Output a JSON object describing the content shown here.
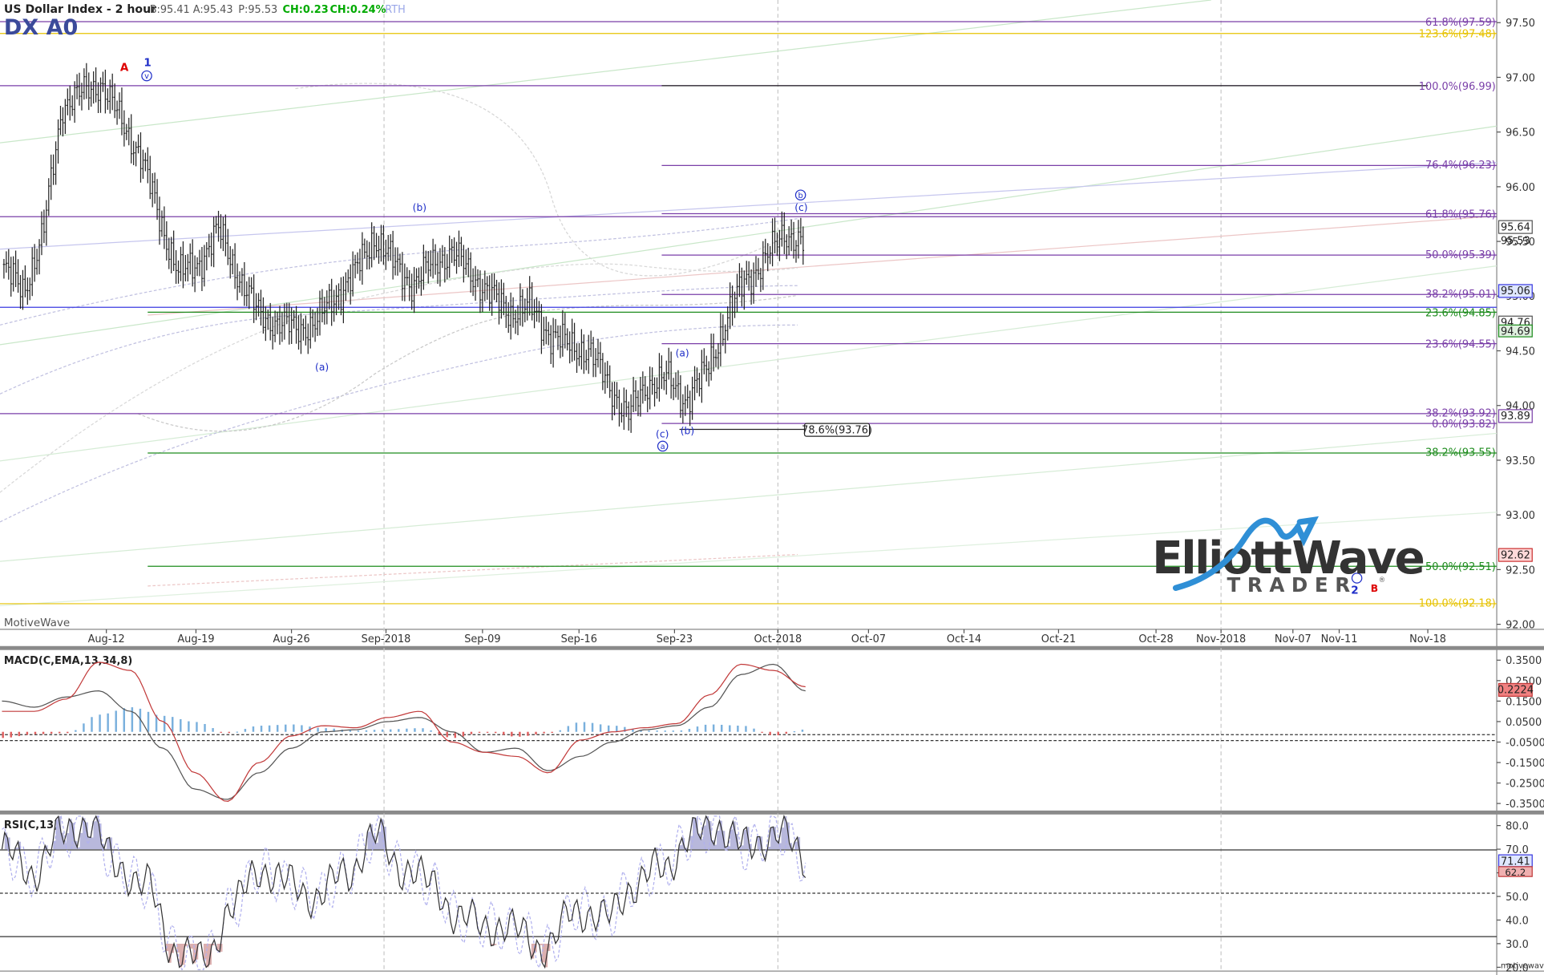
{
  "header": {
    "title": "US Dollar Index - 2 hour",
    "symbol": "DX A0",
    "bid": "B:95.41",
    "ask": "A:95.43",
    "price": "P:95.53",
    "change": "CH:0.23",
    "change_pct": "CH:0.24%",
    "session": "RTH"
  },
  "brand": {
    "watermark": "MotiveWave",
    "footer": "motivewave.com",
    "logo_word_1": "Elliott",
    "logo_word_2": "Wave",
    "logo_sub": "TRADER",
    "logo_reg": "®"
  },
  "colors": {
    "up_text": "#00aa00",
    "fib_purple": "#7a3fa8",
    "fib_green": "#1e8c1e",
    "fib_yellow": "#e6c200",
    "fib_black": "#222222",
    "wave_blue": "#1f2ec8",
    "wave_red": "#dd0000",
    "macd_line": "#c23a3a",
    "signal_line": "#555555",
    "hist_up": "#7ab0dd",
    "hist_down": "#e06060",
    "logo_blue": "#2f8fd6"
  },
  "chart_data": [
    {
      "type": "candlestick",
      "title": "US Dollar Index - 2 hour",
      "x_axis_ticks": [
        "Aug-12",
        "Aug-19",
        "Aug-26",
        "Sep-2018",
        "Sep-09",
        "Sep-16",
        "Sep-23",
        "Oct-2018",
        "Oct-07",
        "Oct-14",
        "Oct-21",
        "Oct-28",
        "Nov-2018",
        "Nov-07",
        "Nov-11",
        "Nov-18"
      ],
      "y_axis_ticks": [
        "97.50",
        "97.00",
        "96.50",
        "96.00",
        "95.50",
        "95.00",
        "94.50",
        "94.00",
        "93.50",
        "93.00",
        "92.50",
        "92.00"
      ],
      "ylim": [
        91.99,
        97.68
      ],
      "price_series": [
        {
          "date": "Aug-08",
          "close": 95.25
        },
        {
          "date": "Aug-09",
          "close": 95.05
        },
        {
          "date": "Aug-10",
          "close": 95.55
        },
        {
          "date": "Aug-13",
          "close": 96.75
        },
        {
          "date": "Aug-14",
          "close": 96.85
        },
        {
          "date": "Aug-15",
          "close": 96.95
        },
        {
          "date": "Aug-16",
          "close": 96.6
        },
        {
          "date": "Aug-17",
          "close": 96.3
        },
        {
          "date": "Aug-20",
          "close": 95.7
        },
        {
          "date": "Aug-21",
          "close": 95.2
        },
        {
          "date": "Aug-22",
          "close": 95.3
        },
        {
          "date": "Aug-23",
          "close": 95.6
        },
        {
          "date": "Aug-24",
          "close": 95.2
        },
        {
          "date": "Aug-27",
          "close": 94.85
        },
        {
          "date": "Aug-28",
          "close": 94.75
        },
        {
          "date": "Aug-29",
          "close": 94.7
        },
        {
          "date": "Aug-30",
          "close": 94.75
        },
        {
          "date": "Aug-31",
          "close": 95.0
        },
        {
          "date": "Sep-03",
          "close": 95.2
        },
        {
          "date": "Sep-04",
          "close": 95.55
        },
        {
          "date": "Sep-05",
          "close": 95.3
        },
        {
          "date": "Sep-06",
          "close": 95.1
        },
        {
          "date": "Sep-07",
          "close": 95.3
        },
        {
          "date": "Sep-10",
          "close": 95.4
        },
        {
          "date": "Sep-11",
          "close": 95.2
        },
        {
          "date": "Sep-12",
          "close": 95.0
        },
        {
          "date": "Sep-13",
          "close": 94.85
        },
        {
          "date": "Sep-14",
          "close": 94.9
        },
        {
          "date": "Sep-17",
          "close": 94.65
        },
        {
          "date": "Sep-18",
          "close": 94.55
        },
        {
          "date": "Sep-19",
          "close": 94.5
        },
        {
          "date": "Sep-20",
          "close": 94.2
        },
        {
          "date": "Sep-21",
          "close": 93.9
        },
        {
          "date": "Sep-24",
          "close": 94.2
        },
        {
          "date": "Sep-25",
          "close": 94.25
        },
        {
          "date": "Sep-26",
          "close": 94.05
        },
        {
          "date": "Sep-27",
          "close": 94.3
        },
        {
          "date": "Sep-28",
          "close": 94.75
        },
        {
          "date": "Oct-01",
          "close": 95.15
        },
        {
          "date": "Oct-02",
          "close": 95.3
        },
        {
          "date": "Oct-03",
          "close": 95.6
        },
        {
          "date": "Oct-04",
          "close": 95.45
        }
      ],
      "price_labels": [
        "95.64",
        "95.53",
        "95.06",
        "94.76",
        "94.69",
        "93.89",
        "92.62"
      ],
      "fib_levels": [
        {
          "label": "61.8%(97.59)",
          "value": 97.59
        },
        {
          "label": "123.6%(97.48)",
          "value": 97.48
        },
        {
          "label": "100.0%(96.99)",
          "value": 96.99
        },
        {
          "label": "76.4%(96.23)",
          "value": 96.23
        },
        {
          "label": "61.8%(95.76)",
          "value": 95.76
        },
        {
          "label": "50.0%(95.39)",
          "value": 95.39
        },
        {
          "label": "38.2%(95.01)",
          "value": 95.01
        },
        {
          "label": "23.6%(94.85)",
          "value": 94.85
        },
        {
          "label": "23.6%(94.55)",
          "value": 94.55
        },
        {
          "label": "38.2%(93.92)",
          "value": 93.92
        },
        {
          "label": "0.0%(93.82)",
          "value": 93.82
        },
        {
          "label": "78.6%(93.76)",
          "value": 93.76
        },
        {
          "label": "38.2%(93.55)",
          "value": 93.55
        },
        {
          "label": "50.0%(92.51)",
          "value": 92.51
        },
        {
          "label": "100.0%(92.18)",
          "value": 92.18
        }
      ],
      "wave_labels": [
        "A",
        "1",
        "v",
        "(b)",
        "(a)",
        "(a)",
        "(b)",
        "(c)",
        "a",
        "b",
        "(c)",
        "2",
        "B"
      ]
    },
    {
      "type": "line",
      "title": "MACD(C,EMA,13,34,8)",
      "y_axis_ticks": [
        "0.3500",
        "0.2500",
        "0.1500",
        "0.0500",
        "-0.0500",
        "-0.1500",
        "-0.2500",
        "-0.3500"
      ],
      "ylim": [
        -0.37,
        0.39
      ],
      "series": [
        {
          "values": [
            0.1,
            0.1,
            0.16,
            0.34,
            0.3,
            0.05,
            -0.2,
            -0.34,
            -0.15,
            -0.02,
            0.03,
            0.02,
            0.07,
            0.1,
            -0.05,
            -0.1,
            -0.12,
            -0.2,
            -0.04,
            0.0,
            0.02,
            0.04,
            0.18,
            0.33,
            0.3,
            0.22
          ]
        },
        {
          "values": [
            0.15,
            0.12,
            0.17,
            0.2,
            0.1,
            -0.08,
            -0.28,
            -0.33,
            -0.2,
            -0.08,
            0.0,
            0.01,
            0.05,
            0.07,
            0.0,
            -0.1,
            -0.08,
            -0.19,
            -0.12,
            -0.05,
            0.01,
            0.03,
            0.12,
            0.28,
            0.33,
            0.2
          ]
        }
      ],
      "current_value": "0.2224"
    },
    {
      "type": "line",
      "title": "RSI(C,13)",
      "y_axis_ticks": [
        "80.0",
        "70.0",
        "60.0",
        "50.0",
        "40.0",
        "30.0",
        "20.0"
      ],
      "ylim": [
        18.4,
        84.7
      ],
      "series": [
        {
          "values": [
            70,
            60,
            75,
            82,
            63,
            55,
            28,
            22,
            45,
            62,
            55,
            50,
            60,
            75,
            62,
            55,
            40,
            38,
            35,
            28,
            45,
            40,
            55,
            62,
            75,
            80,
            70,
            78,
            65
          ]
        }
      ],
      "current_value": "71.41",
      "secondary_value": "62.2"
    }
  ]
}
